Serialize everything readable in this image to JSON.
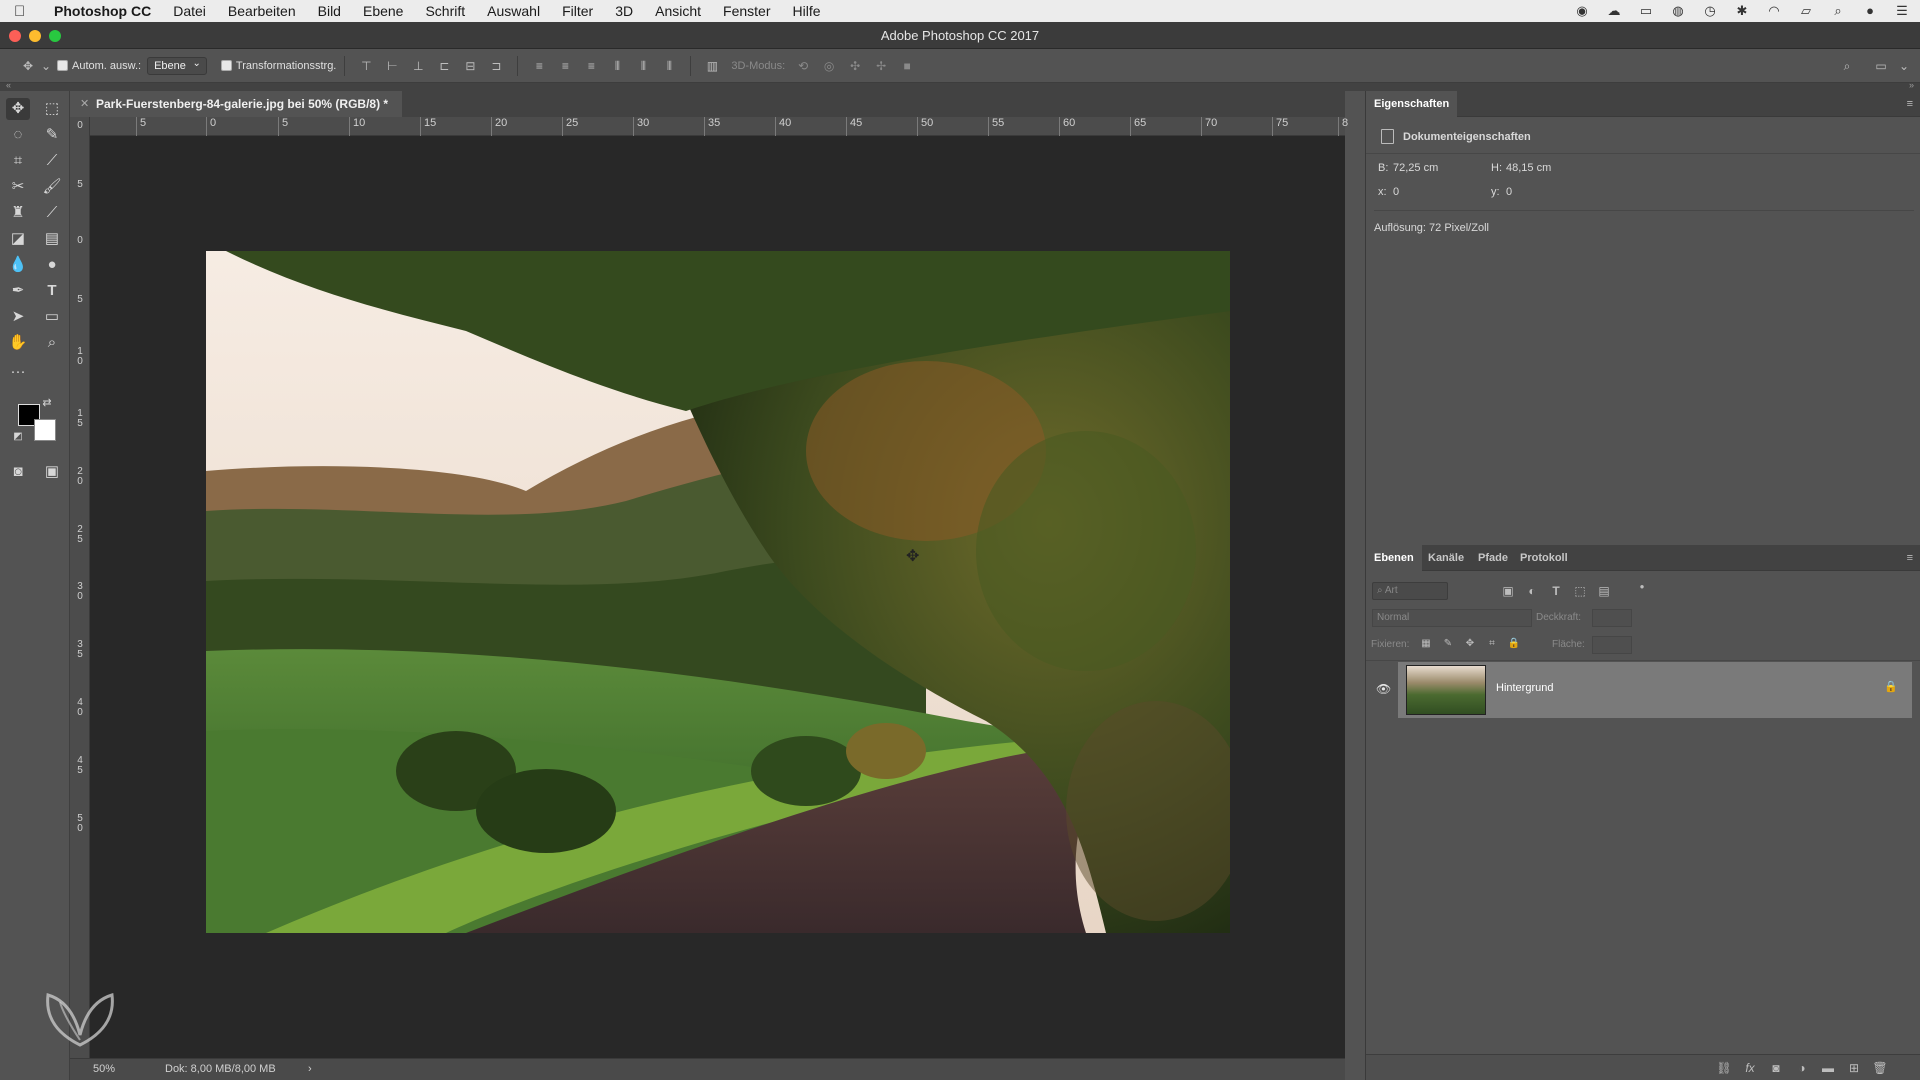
{
  "menubar": {
    "apple": "",
    "app": "Photoshop CC",
    "items": [
      "Datei",
      "Bearbeiten",
      "Bild",
      "Ebene",
      "Schrift",
      "Auswahl",
      "Filter",
      "3D",
      "Ansicht",
      "Fenster",
      "Hilfe"
    ]
  },
  "window": {
    "title": "Adobe Photoshop CC 2017"
  },
  "options": {
    "auto_select_label": "Autom. ausw.:",
    "auto_select_value": "Ebene",
    "transform_label": "Transformationsstrg.",
    "mode3d_label": "3D-Modus:"
  },
  "document": {
    "tab_label": "Park-Fuerstenberg-84-galerie.jpg bei 50% (RGB/8) *",
    "zoom": "50%",
    "doc_info": "Dok: 8,00 MB/8,00 MB"
  },
  "ruler": {
    "top_labels": [
      "5",
      "0",
      "5",
      "10",
      "15",
      "20",
      "25",
      "30",
      "35",
      "40",
      "45",
      "50",
      "55",
      "60",
      "65",
      "70",
      "75",
      "8"
    ],
    "left_labels": [
      "0",
      "5",
      "0",
      "5",
      "1 0",
      "1 5",
      "2 0",
      "2 5",
      "3 0",
      "3 5",
      "4 0",
      "4 5",
      "5 0"
    ]
  },
  "properties": {
    "tab": "Eigenschaften",
    "section": "Dokumenteigenschaften",
    "width_label": "B:",
    "width": "72,25 cm",
    "height_label": "H:",
    "height": "48,15 cm",
    "x_label": "x:",
    "x": "0",
    "y_label": "y:",
    "y": "0",
    "resolution": "Auflösung: 72 Pixel/Zoll"
  },
  "layers_panel": {
    "tabs": [
      "Ebenen",
      "Kanäle",
      "Pfade",
      "Protokoll"
    ],
    "filter_placeholder": "Art",
    "blend_mode": "Normal",
    "opacity_label": "Deckkraft:",
    "lock_label": "Fixieren:",
    "fill_label": "Fläche:",
    "layers": [
      {
        "name": "Hintergrund"
      }
    ]
  },
  "colors": {
    "foreground": "#000000",
    "background": "#ffffff"
  }
}
